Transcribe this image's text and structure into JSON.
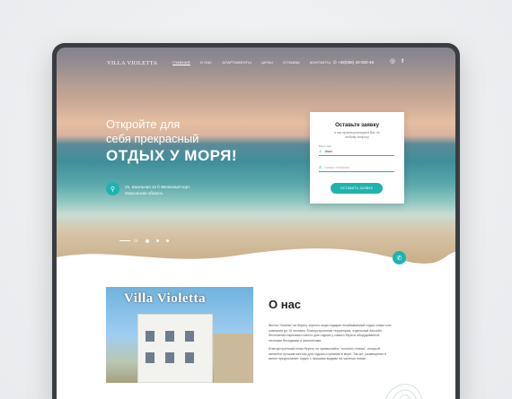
{
  "header": {
    "logo": "VILLA VIOLETTA",
    "menu": [
      "ГЛАВНАЯ",
      "О НАС",
      "АПАРТАМЕНТЫ",
      "ЦЕНЫ",
      "ОТЗЫВЫ",
      "КОНТАКТЫ"
    ],
    "active_menu": "ГЛАВНАЯ",
    "phone": "+38(068) 40-000-48",
    "socials": [
      "instagram-icon",
      "facebook-icon"
    ]
  },
  "hero": {
    "line1": "Откройте для",
    "line2": "себя прекрасный",
    "line3": "ОТДЫХ У МОРЯ!",
    "address_line1": "Ул. Школьная 12 б Железный порт",
    "address_line2": "Херсонская область",
    "slide_number": "01"
  },
  "form": {
    "title": "Оставьте заявку",
    "subtitle": "и мы проконсультируем Вас по любому вопросу",
    "name_label": "Ваше имя",
    "name_value": "Иван",
    "phone_placeholder": "Номер телефона",
    "submit_label": "ОСТАВИТЬ ЗАЯВКУ"
  },
  "about": {
    "title": "О нас",
    "photo_sign": "Villa Violetta",
    "paragraph1": "Вилла \"Violetta\" на берегу черного моря подарит незабываемый отдых семье или компании до 15 человек. Благоустроенная территория, отдельный бассейн, бесплатная парковка и место для отдыха у самого берега оборудованное личными беседками и шезлонгами.",
    "paragraph2": "Благоустроенный пляж берегу на чрезвычайно \"золотого пляжа\", который является лучшим местом для отдыха и купания в море. Так же, размещение в вилле предполагает отдых с лучшими видами на частном пляже."
  },
  "colors": {
    "accent": "#1fb3b0"
  }
}
